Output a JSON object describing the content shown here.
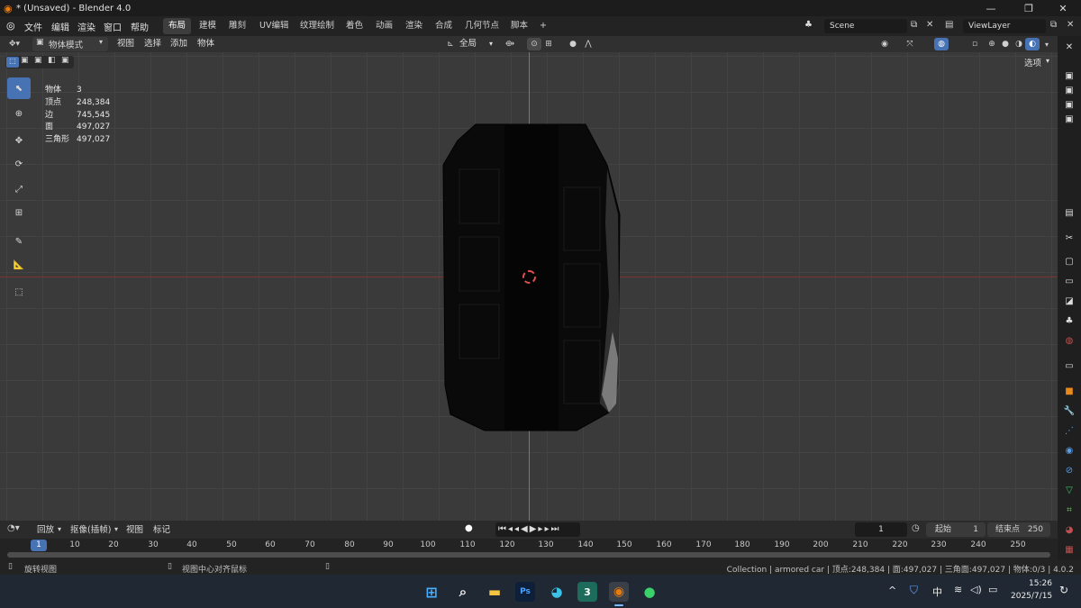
{
  "window": {
    "title": "* (Unsaved) - Blender 4.0",
    "controls": [
      "—",
      "❐",
      "✕"
    ]
  },
  "menubar": {
    "menus": [
      "文件",
      "编辑",
      "渲染",
      "窗口",
      "帮助"
    ],
    "workspaces": [
      "布局",
      "建模",
      "雕刻",
      "UV编辑",
      "纹理绘制",
      "着色",
      "动画",
      "渲染",
      "合成",
      "几何节点",
      "脚本",
      "+"
    ],
    "active_workspace": "布局",
    "scene": "Scene",
    "view_layer": "ViewLayer"
  },
  "viewport_header": {
    "mode": "物体模式",
    "menus": [
      "视图",
      "选择",
      "添加",
      "物体"
    ],
    "transform_orientation": "全局",
    "options_label": "选项"
  },
  "stats": [
    {
      "label": "物体",
      "value": "3"
    },
    {
      "label": "顶点",
      "value": "248,384"
    },
    {
      "label": "边",
      "value": "745,545"
    },
    {
      "label": "面",
      "value": "497,027"
    },
    {
      "label": "三角形",
      "value": "497,027"
    }
  ],
  "tools": [
    "select-icon",
    "cursor-icon",
    "move-icon",
    "rotate-icon",
    "scale-icon",
    "transform-icon",
    "annotate-icon",
    "measure-icon",
    "add-cube-icon"
  ],
  "timeline": {
    "menus": [
      "回放",
      "抠像(插帧)",
      "视图",
      "标记"
    ],
    "current_frame": "1",
    "start_label": "起始",
    "start": "1",
    "end_label": "结束点",
    "end": "250",
    "ticks": [
      "1",
      "10",
      "20",
      "30",
      "40",
      "50",
      "60",
      "70",
      "80",
      "90",
      "100",
      "110",
      "120",
      "130",
      "140",
      "150",
      "160",
      "170",
      "180",
      "190",
      "200",
      "210",
      "220",
      "230",
      "240",
      "250"
    ]
  },
  "statusbar": {
    "left_hint": "旋转视图",
    "mid_hint": "视图中心对齐鼠标",
    "info": "Collection | armored car | 顶点:248,384 | 面:497,027 | 三角面:497,027 | 物体:0/3 | 4.0.2"
  },
  "taskbar": {
    "tray_chevron": "^",
    "ime": "中",
    "time": "15:26",
    "date": "2025/7/15"
  },
  "colors": {
    "accent": "#4772b3",
    "x_axis": "#8a3a3a",
    "y_axis": "#6a8a2a"
  }
}
